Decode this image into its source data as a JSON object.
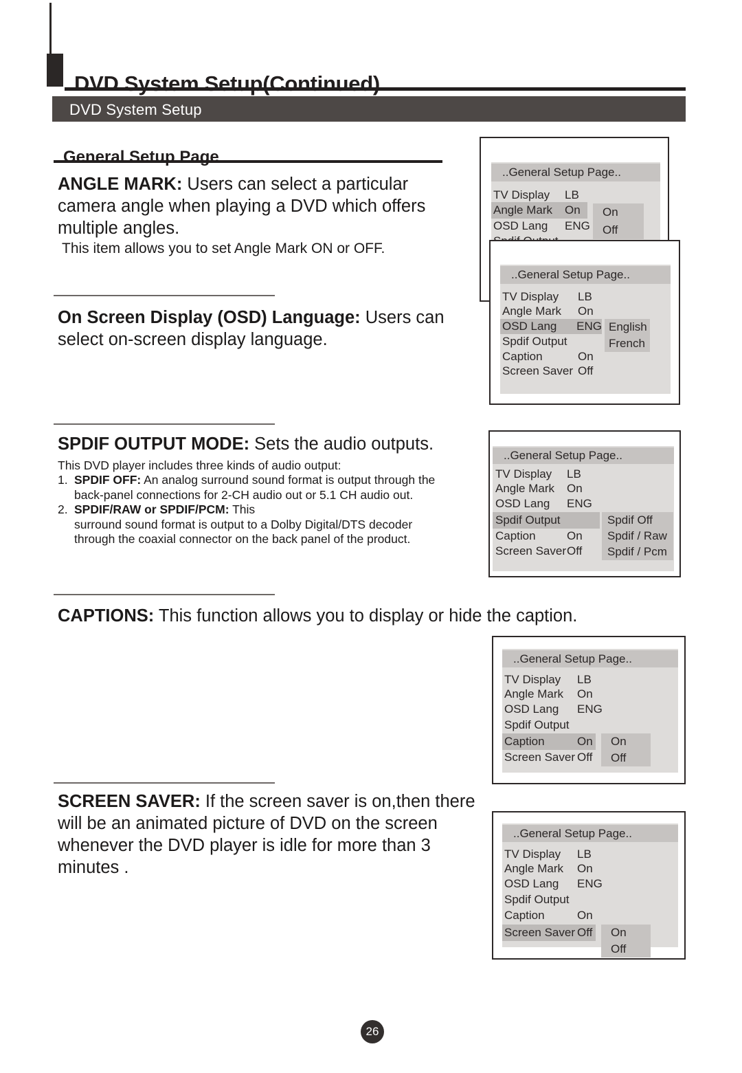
{
  "page": {
    "chapter_title": "DVD System Setup(Continued)",
    "section_bar_label": "DVD System Setup",
    "sub_heading": "General Setup Page",
    "page_number": "26"
  },
  "sections": {
    "angle_mark": {
      "term": "ANGLE MARK:",
      "body": " Users can select a particular camera angle when playing  a DVD which offers multiple angles.",
      "note": "This item allows you to set Angle Mark ON or OFF."
    },
    "osd_language": {
      "term": "On  Screen  Display (OSD) Language:",
      "body": "  Users can select on-screen display language."
    },
    "spdif": {
      "term": "SPDIF OUTPUT MODE:",
      "body": " Sets the audio outputs.",
      "intro": "This DVD player includes three kinds of audio output:",
      "items": [
        {
          "num": "1.",
          "term": "SPDIF OFF:",
          "body": "  An analog surround sound format is output through the",
          "cont": "back-panel connections for 2-CH audio out or 5.1 CH audio out."
        },
        {
          "num": "2.",
          "term": "SPDIF/RAW or SPDIF/PCM:",
          "body": " This",
          "cont": "surround sound  format  is  output to a Dolby  Digital/DTS decoder",
          "cont2": "through the coaxial connector on the  back panel of the product."
        }
      ]
    },
    "captions": {
      "term": "CAPTIONS:",
      "body": " This function allows you to display or hide the caption."
    },
    "screen_saver": {
      "term": "SCREEN SAVER:",
      "body": " If the screen saver is on,then there will be an animated picture of DVD  on the screen whenever the DVD player is idle for more than 3 minutes ."
    }
  },
  "osd": {
    "title": "..General Setup Page..",
    "labels": {
      "tv_display": "TV Display",
      "angle_mark": "Angle Mark",
      "osd_lang": "OSD Lang",
      "spdif_output": "Spdif Output",
      "caption": "Caption",
      "screen_saver": "Screen Saver"
    },
    "values": {
      "tv_display": "LB",
      "angle_mark": "On",
      "osd_lang": "ENG",
      "spdif_output": "",
      "caption": "On",
      "screen_saver": "Off"
    },
    "popups": {
      "angle_mark": [
        "On",
        "Off"
      ],
      "osd_lang": [
        "English",
        "French"
      ],
      "spdif_output": [
        "Spdif Off",
        "Spdif / Raw",
        "Spdif / Pcm"
      ],
      "caption": [
        "On",
        "Off"
      ],
      "screen_saver": [
        "On",
        "Off"
      ]
    }
  },
  "colors": {
    "bar_dark": "#4d4846",
    "rule_dark": "#231f1f",
    "osd_body": "#dedcda",
    "osd_title": "#c6c3c1",
    "osd_highlight": "#bdbab8",
    "badge": "#332f2e"
  }
}
